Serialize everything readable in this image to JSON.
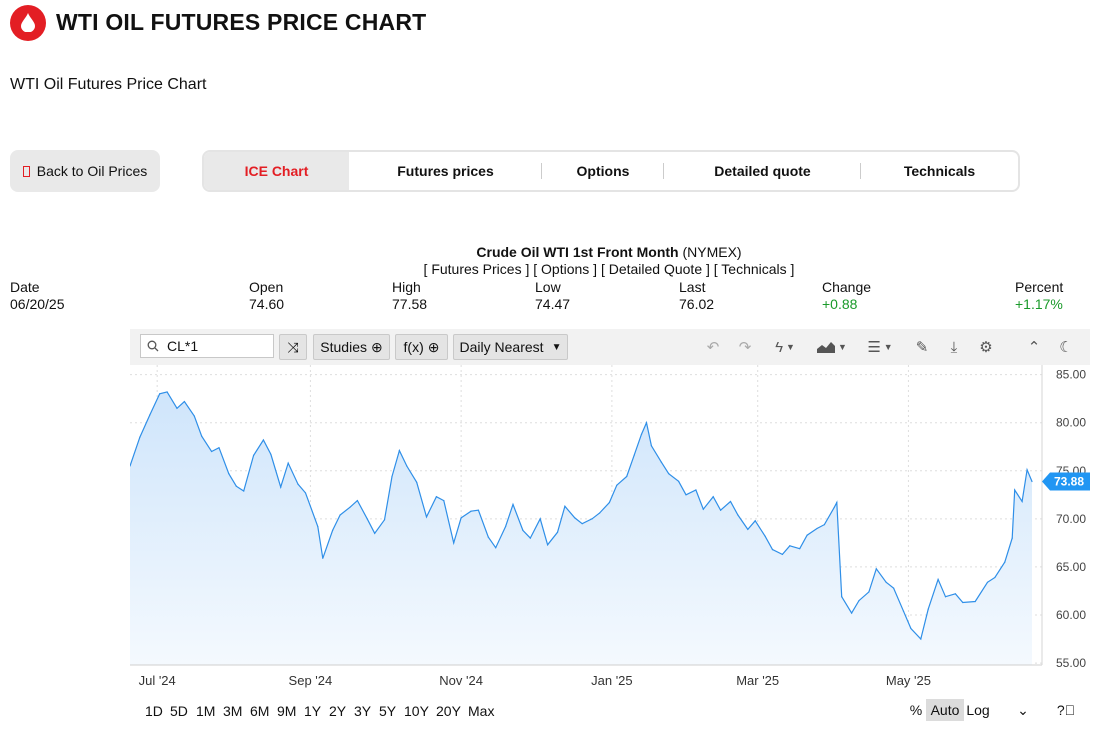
{
  "header": {
    "title": "WTI OIL FUTURES PRICE CHART",
    "subtitle": "WTI Oil Futures Price Chart"
  },
  "nav": {
    "back_label": "Back to Oil Prices",
    "tabs": [
      {
        "label": "ICE Chart",
        "active": true
      },
      {
        "label": "Futures prices",
        "active": false
      },
      {
        "label": "Options",
        "active": false
      },
      {
        "label": "Detailed quote",
        "active": false
      },
      {
        "label": "Technicals",
        "active": false
      }
    ]
  },
  "quote": {
    "title_bold": "Crude Oil WTI 1st Front Month",
    "title_exchange": "(NYMEX)",
    "links": "[ Futures Prices ] [ Options ] [ Detailed Quote ] [ Technicals ]",
    "date_label": "Date",
    "date": "06/20/25",
    "open_label": "Open",
    "open": "74.60",
    "high_label": "High",
    "high": "77.58",
    "low_label": "Low",
    "low": "74.47",
    "last_label": "Last",
    "last": "76.02",
    "change_label": "Change",
    "change": "+0.88",
    "percent_label": "Percent",
    "percent": "+1.17%"
  },
  "toolbar": {
    "symbol": "CL*1",
    "studies_label": "Studies",
    "fx_label": "f(x)",
    "period_label": "Daily Nearest"
  },
  "ranges": [
    "1D",
    "5D",
    "1M",
    "3M",
    "6M",
    "9M",
    "1Y",
    "2Y",
    "3Y",
    "5Y",
    "10Y",
    "20Y",
    "Max"
  ],
  "scale": {
    "percent": "%",
    "auto": "Auto",
    "log": "Log"
  },
  "colors": {
    "accent": "#e31e24",
    "line": "#2f8fe8",
    "area_top": "#cfe5fb",
    "price_tag": "#2196f3",
    "positive": "#1a9a2a"
  },
  "chart_data": {
    "type": "area",
    "x_tick_labels": [
      "Jul '24",
      "Sep '24",
      "Nov '24",
      "Jan '25",
      "Mar '25",
      "May '25"
    ],
    "y_ticks": [
      55,
      60,
      65,
      70,
      75,
      80,
      85
    ],
    "ylim": [
      54.8,
      86
    ],
    "last_price_label": "73.88",
    "x": [
      "2024-06-20",
      "2024-06-24",
      "2024-06-28",
      "2024-07-02",
      "2024-07-05",
      "2024-07-09",
      "2024-07-12",
      "2024-07-16",
      "2024-07-19",
      "2024-07-23",
      "2024-07-26",
      "2024-07-30",
      "2024-08-02",
      "2024-08-05",
      "2024-08-09",
      "2024-08-13",
      "2024-08-16",
      "2024-08-20",
      "2024-08-23",
      "2024-08-27",
      "2024-08-30",
      "2024-09-04",
      "2024-09-06",
      "2024-09-10",
      "2024-09-13",
      "2024-09-17",
      "2024-09-20",
      "2024-09-24",
      "2024-09-27",
      "2024-10-01",
      "2024-10-04",
      "2024-10-07",
      "2024-10-10",
      "2024-10-14",
      "2024-10-18",
      "2024-10-22",
      "2024-10-25",
      "2024-10-29",
      "2024-11-01",
      "2024-11-05",
      "2024-11-08",
      "2024-11-12",
      "2024-11-15",
      "2024-11-19",
      "2024-11-22",
      "2024-11-26",
      "2024-11-29",
      "2024-12-03",
      "2024-12-06",
      "2024-12-10",
      "2024-12-13",
      "2024-12-17",
      "2024-12-20",
      "2024-12-24",
      "2024-12-27",
      "2024-12-31",
      "2025-01-03",
      "2025-01-07",
      "2025-01-10",
      "2025-01-13",
      "2025-01-15",
      "2025-01-17",
      "2025-01-21",
      "2025-01-24",
      "2025-01-28",
      "2025-01-31",
      "2025-02-04",
      "2025-02-07",
      "2025-02-11",
      "2025-02-14",
      "2025-02-18",
      "2025-02-21",
      "2025-02-25",
      "2025-02-28",
      "2025-03-04",
      "2025-03-07",
      "2025-03-11",
      "2025-03-14",
      "2025-03-18",
      "2025-03-21",
      "2025-03-25",
      "2025-03-28",
      "2025-04-01",
      "2025-04-02",
      "2025-04-04",
      "2025-04-08",
      "2025-04-11",
      "2025-04-15",
      "2025-04-18",
      "2025-04-22",
      "2025-04-25",
      "2025-04-29",
      "2025-05-02",
      "2025-05-06",
      "2025-05-09",
      "2025-05-13",
      "2025-05-16",
      "2025-05-20",
      "2025-05-23",
      "2025-05-28",
      "2025-06-02",
      "2025-06-05",
      "2025-06-09",
      "2025-06-12",
      "2025-06-13",
      "2025-06-16",
      "2025-06-18",
      "2025-06-20"
    ],
    "y": [
      75.5,
      78.5,
      80.8,
      83.0,
      83.2,
      81.5,
      82.2,
      80.7,
      78.6,
      77.0,
      77.4,
      74.7,
      73.4,
      72.9,
      76.6,
      78.2,
      76.7,
      73.3,
      75.8,
      73.6,
      72.7,
      69.2,
      65.9,
      68.8,
      70.4,
      71.2,
      71.9,
      70.0,
      68.5,
      69.9,
      74.4,
      77.1,
      75.5,
      73.8,
      70.2,
      72.3,
      71.9,
      67.5,
      70.1,
      70.8,
      70.9,
      68.1,
      67.0,
      69.2,
      71.5,
      68.8,
      68.0,
      70.0,
      67.3,
      68.6,
      71.3,
      70.1,
      69.5,
      70.0,
      70.6,
      71.7,
      73.5,
      74.4,
      76.6,
      78.8,
      80.0,
      77.6,
      75.9,
      74.7,
      73.9,
      72.5,
      73.0,
      71.0,
      72.3,
      70.9,
      71.8,
      70.4,
      68.9,
      69.8,
      68.2,
      66.8,
      66.3,
      67.2,
      66.9,
      68.3,
      69.0,
      69.4,
      71.2,
      71.7,
      61.9,
      60.2,
      61.5,
      62.4,
      64.8,
      63.4,
      62.8,
      60.4,
      58.6,
      57.5,
      60.6,
      63.7,
      61.9,
      62.2,
      61.3,
      61.4,
      63.4,
      63.9,
      65.5,
      68.0,
      73.0,
      71.8,
      75.1,
      73.88
    ]
  }
}
